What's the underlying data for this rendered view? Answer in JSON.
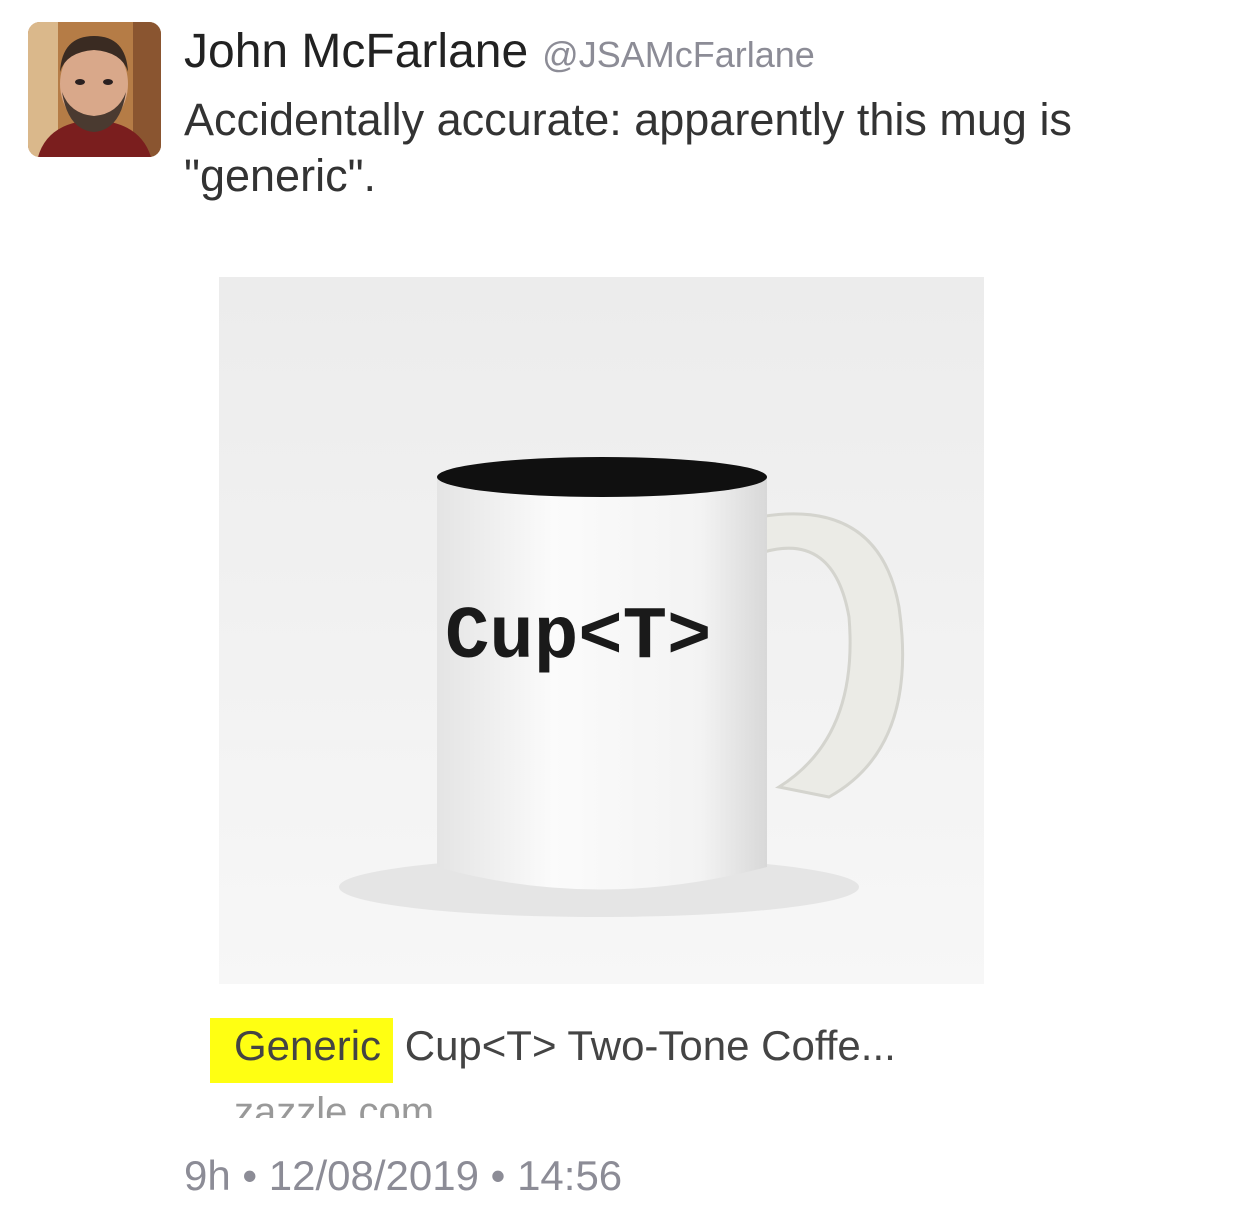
{
  "tweet": {
    "author_name": "John McFarlane",
    "author_handle": "@JSAMcFarlane",
    "text_line1": "Accidentally accurate: apparently this mug is",
    "text_line2": "\"generic\".",
    "media": {
      "mug_text": "Cup<T>",
      "link_title_highlight": "Generic",
      "link_title_rest": " Cup<T> Two-Tone Coffe...",
      "link_domain": "zazzle.com",
      "highlight_color": "#ffff12"
    },
    "meta": {
      "relative_time": "9h",
      "separator": "•",
      "date": "12/08/2019",
      "time": "14:56"
    }
  }
}
